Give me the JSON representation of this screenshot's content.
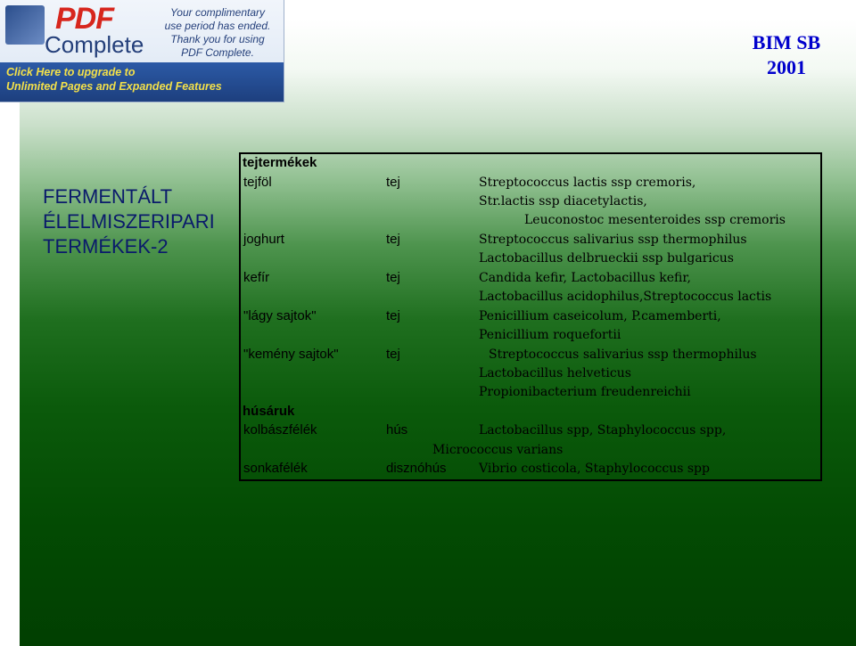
{
  "watermark": {
    "product_first": "PDF",
    "product_second": "Complete",
    "promo_lines": [
      "Your complimentary",
      "use period has ended.",
      "Thank you for using",
      "PDF Complete."
    ],
    "upgrade_lines": [
      "Click Here to upgrade to",
      "Unlimited Pages and Expanded Features"
    ]
  },
  "header": {
    "org_line1": "BIM  SB",
    "org_line2": "2001"
  },
  "title_lines": [
    "FERMENTÁLT",
    "ÉLELMISZERIPARI",
    "TERMÉKEK-2"
  ],
  "table": {
    "sections": [
      {
        "heading": "tejtermékek",
        "rows": [
          {
            "product": "tejföl",
            "raw": "tej",
            "organisms": [
              "Streptococcus lactis ssp cremoris,",
              "Str.lactis ssp diacetylactis,",
              "Leuconostoc mesenteroides ssp cremoris"
            ]
          },
          {
            "product": "joghurt",
            "raw": "tej",
            "organisms": [
              "Streptococcus salivarius ssp thermophilus",
              "Lactobacillus delbrueckii ssp bulgaricus"
            ]
          },
          {
            "product": "kefír",
            "raw": "tej",
            "organisms": [
              "Candida kefir, Lactobacillus kefir,",
              "Lactobacillus acidophilus,Streptococcus lactis"
            ]
          },
          {
            "product": "\"lágy sajtok\"",
            "raw": "tej",
            "organisms": [
              "Penicillium caseicolum, P.camemberti,",
              "Penicillium roquefortii"
            ]
          },
          {
            "product": "\"kemény sajtok\"",
            "raw": "tej",
            "organisms": [
              "Streptococcus salivarius ssp thermophilus",
              "Lactobacillus helveticus",
              "Propionibacterium freudenreichii"
            ]
          }
        ]
      },
      {
        "heading": "húsáruk",
        "rows": [
          {
            "product": "kolbászfélék",
            "raw": "hús",
            "organisms": [
              "Lactobacillus spp, Staphylococcus spp,",
              "Micrococcus varians"
            ]
          },
          {
            "product": "sonkafélék",
            "raw": "disznóhús",
            "organisms": [
              "Vibrio costicola, Staphylococcus spp"
            ]
          }
        ]
      }
    ]
  }
}
